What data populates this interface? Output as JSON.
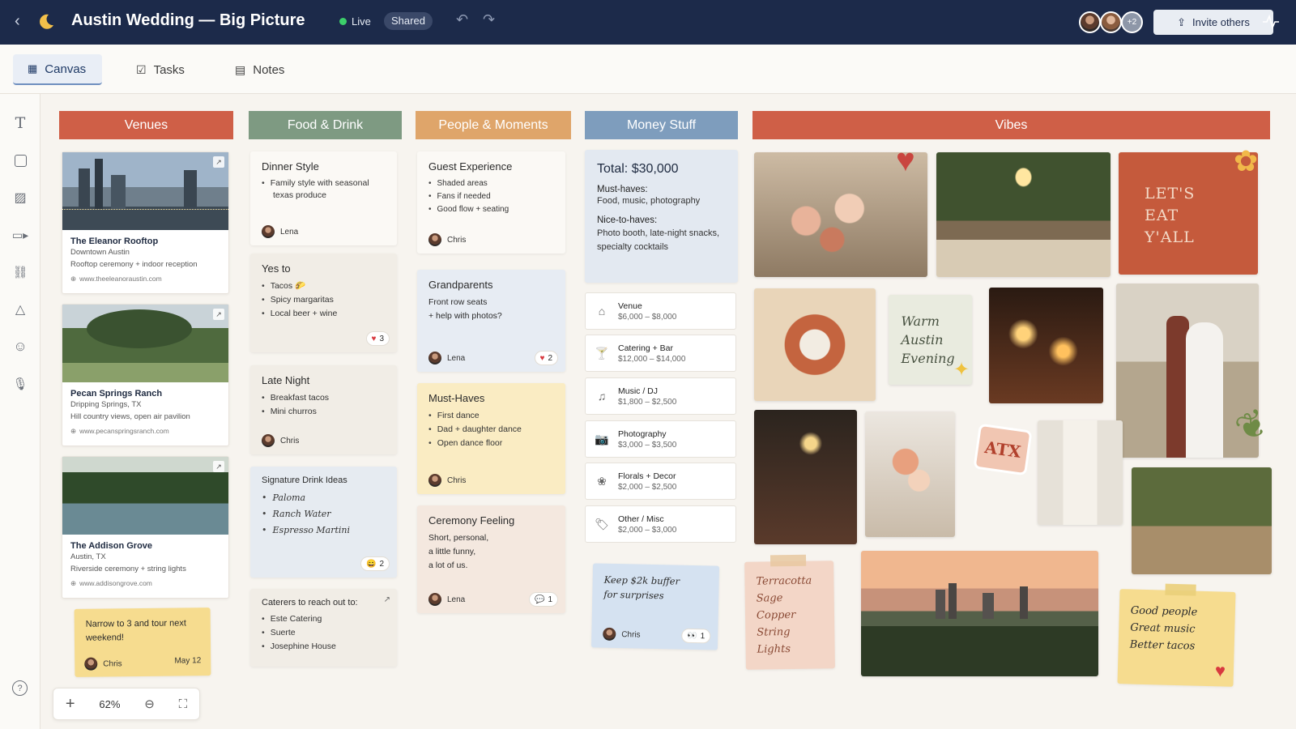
{
  "header": {
    "title": "Austin Wedding — Big Picture",
    "live": "Live",
    "shared": "Shared",
    "more_count": "+2",
    "invite": "Invite others"
  },
  "tabs": [
    {
      "label": "Canvas"
    },
    {
      "label": "Tasks"
    },
    {
      "label": "Notes"
    }
  ],
  "columns": {
    "venues": "Venues",
    "food": "Food & Drink",
    "people": "People & Moments",
    "money": "Money Stuff",
    "vibes": "Vibes"
  },
  "venues": [
    {
      "name": "The Eleanor Rooftop",
      "loc": "Downtown Austin",
      "desc": "Rooftop ceremony + indoor reception",
      "url": "www.theeleanoraustin.com"
    },
    {
      "name": "Pecan Springs Ranch",
      "loc": "Dripping Springs, TX",
      "desc": "Hill country views, open air pavilion",
      "url": "www.pecanspringsranch.com"
    },
    {
      "name": "The Addison Grove",
      "loc": "Austin, TX",
      "desc": "Riverside ceremony + string lights",
      "url": "www.addisongrove.com"
    }
  ],
  "sticky_venue": {
    "text": "Narrow to 3 and tour next weekend!",
    "author": "Chris",
    "date": "May 12"
  },
  "food": {
    "dinner": {
      "title": "Dinner Style",
      "items": [
        "Family style with seasonal texas produce"
      ],
      "author": "Lena"
    },
    "yes": {
      "title": "Yes to",
      "items": [
        "Tacos 🌮",
        "Spicy margaritas",
        "Local beer + wine"
      ],
      "reactions": "3"
    },
    "late": {
      "title": "Late Night",
      "items": [
        "Breakfast tacos",
        "Mini churros"
      ],
      "author": "Chris"
    },
    "drinks": {
      "title": "Signature Drink Ideas",
      "items": [
        "Paloma",
        "Ranch Water",
        "Espresso Martini"
      ],
      "reactions": "2"
    },
    "caterers": {
      "title": "Caterers to reach out to:",
      "items": [
        "Este Catering",
        "Suerte",
        "Josephine House"
      ]
    }
  },
  "people": {
    "guest": {
      "title": "Guest Experience",
      "items": [
        "Shaded areas",
        "Fans if needed",
        "Good flow + seating"
      ],
      "author": "Chris"
    },
    "grand": {
      "title": "Grandparents",
      "line1": "Front row seats",
      "line2": "+ help with photos?",
      "author": "Lena",
      "reactions": "2"
    },
    "must": {
      "title": "Must-Haves",
      "items": [
        "First dance",
        "Dad + daughter dance",
        "Open dance floor"
      ],
      "author": "Chris"
    },
    "ceremony": {
      "title": "Ceremony Feeling",
      "line1": "Short, personal,",
      "line2": "a little funny,",
      "line3": "a lot of us.",
      "author": "Lena",
      "comments": "1"
    }
  },
  "money": {
    "total": "Total: $30,000",
    "must_label": "Must-haves:",
    "must_text": "Food, music, photography",
    "nice_label": "Nice-to-haves:",
    "nice_text": "Photo booth, late-night snacks, specialty cocktails",
    "items": [
      {
        "label": "Venue",
        "value": "$6,000 – $8,000",
        "icon": "building-icon"
      },
      {
        "label": "Catering + Bar",
        "value": "$12,000 – $14,000",
        "icon": "glass-icon"
      },
      {
        "label": "Music / DJ",
        "value": "$1,800 – $2,500",
        "icon": "music-icon"
      },
      {
        "label": "Photography",
        "value": "$3,000 – $3,500",
        "icon": "camera-icon"
      },
      {
        "label": "Florals + Decor",
        "value": "$2,000 – $2,500",
        "icon": "flower-icon"
      },
      {
        "label": "Other / Misc",
        "value": "$2,000 – $3,000",
        "icon": "tag-icon"
      }
    ],
    "buffer": {
      "text": "Keep $2k buffer for surprises",
      "author": "Chris",
      "reactions": "1"
    }
  },
  "vibes": {
    "letseat": "LET'S EAT Y'ALL",
    "warm": "Warm Austin Evening",
    "atx": "ATX",
    "terracotta": [
      "Terracotta",
      "Sage",
      "Copper",
      "String Lights"
    ],
    "good": [
      "Good people",
      "Great music",
      "Better tacos"
    ]
  },
  "zoom": {
    "level": "62%"
  },
  "colors": {
    "venues": "#cf5f47",
    "food": "#7e9a82",
    "people": "#dfa56a",
    "money": "#7e9dbd",
    "vibes": "#cf5f47",
    "header": "#1c2a4a"
  }
}
